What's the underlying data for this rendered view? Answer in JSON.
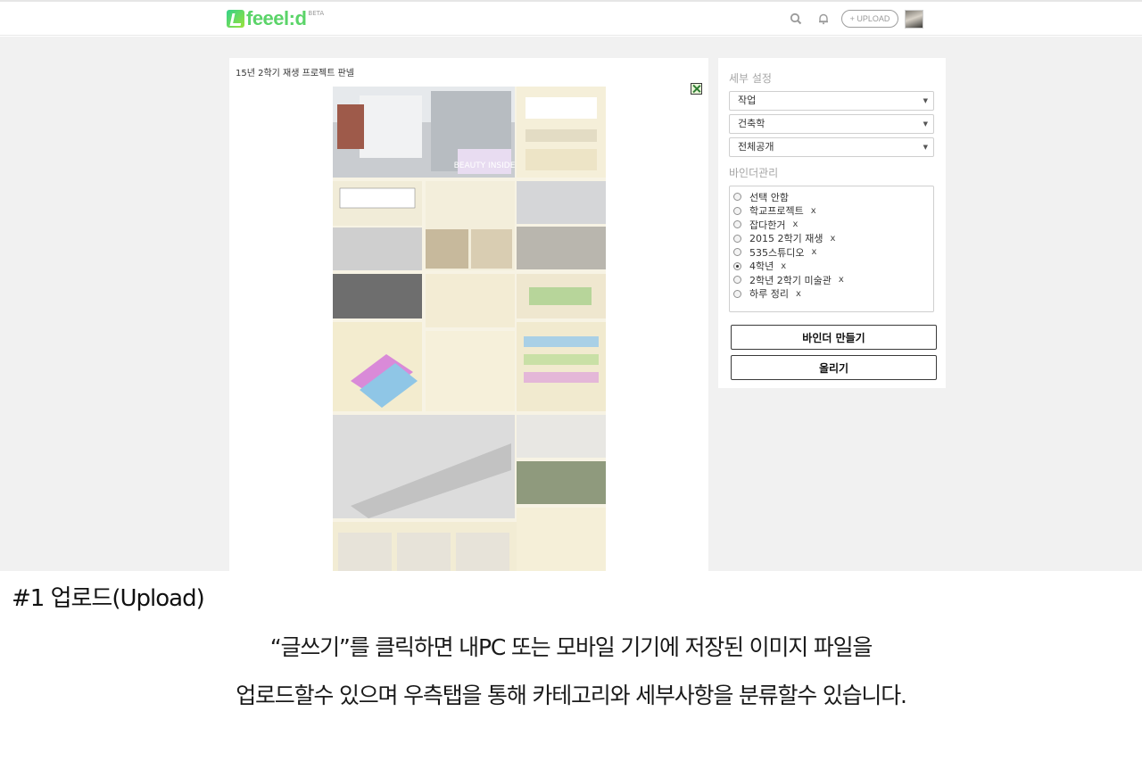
{
  "header": {
    "logo_text": "feeel:d",
    "logo_badge": "BETA",
    "upload_label": "+ UPLOAD"
  },
  "post": {
    "title": "15년 2학기 재생 프로젝트 판넬",
    "poster_headline": "BEAUTY INSIDE"
  },
  "settings": {
    "heading": "세부 설정",
    "selects": [
      "작업",
      "건축학",
      "전체공개"
    ],
    "binder_heading": "바인더관리",
    "binders": [
      {
        "label": "선택 안함",
        "removable": false,
        "checked": false
      },
      {
        "label": "학교프로젝트",
        "removable": true,
        "checked": false
      },
      {
        "label": "잡다한거",
        "removable": true,
        "checked": false
      },
      {
        "label": "2015 2학기 재생",
        "removable": true,
        "checked": false
      },
      {
        "label": "535스튜디오",
        "removable": true,
        "checked": false
      },
      {
        "label": "4학년",
        "removable": true,
        "checked": true
      },
      {
        "label": "2학년 2학기 미술관",
        "removable": true,
        "checked": false
      },
      {
        "label": "하루 정리",
        "removable": true,
        "checked": false
      }
    ],
    "remove_mark": "x",
    "make_binder_label": "바인더 만들기",
    "post_label": "올리기"
  },
  "caption": {
    "heading": "#1 업로드(Upload)",
    "line1": "“글쓰기”를 클릭하면 내PC 또는 모바일 기기에 저장된 이미지 파일을",
    "line2": "업로드할수 있으며 우측탭을 통해 카테고리와 세부사항을 분류할수 있습니다."
  },
  "colors": {
    "brand_green": "#5bd469",
    "page_grey": "#f1f1f1"
  }
}
